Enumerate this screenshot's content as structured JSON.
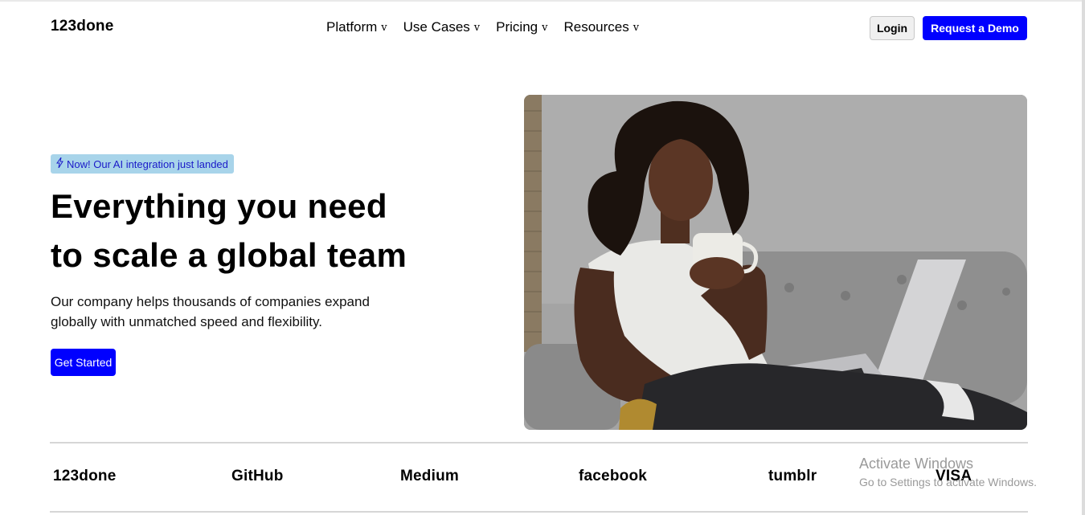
{
  "header": {
    "brand": "123done",
    "nav": [
      {
        "label": "Platform",
        "chevron": "v"
      },
      {
        "label": "Use Cases",
        "chevron": "v"
      },
      {
        "label": "Pricing",
        "chevron": "v"
      },
      {
        "label": "Resources",
        "chevron": "v"
      }
    ],
    "login_label": "Login",
    "demo_label": "Request a Demo"
  },
  "hero": {
    "badge_icon": "lightning-bolt-icon",
    "badge_text": "Now! Our AI integration just landed",
    "headline_line1": "Everything you need",
    "headline_line2": "to scale a global team",
    "subtext_line1": "Our company helps thousands of companies expand",
    "subtext_line2": "globally with unmatched speed and flexibility.",
    "cta_label": "Get Started",
    "image": "woman-with-coffee-and-laptop-photo"
  },
  "logos": [
    "123done",
    "GitHub",
    "Medium",
    "facebook",
    "tumblr",
    "VISA"
  ],
  "watermark": {
    "title": "Activate Windows",
    "subtitle": "Go to Settings to activate Windows."
  },
  "colors": {
    "accent": "#0000ff",
    "badge_bg": "#a8d4ea",
    "badge_text": "#1a1ac8"
  }
}
